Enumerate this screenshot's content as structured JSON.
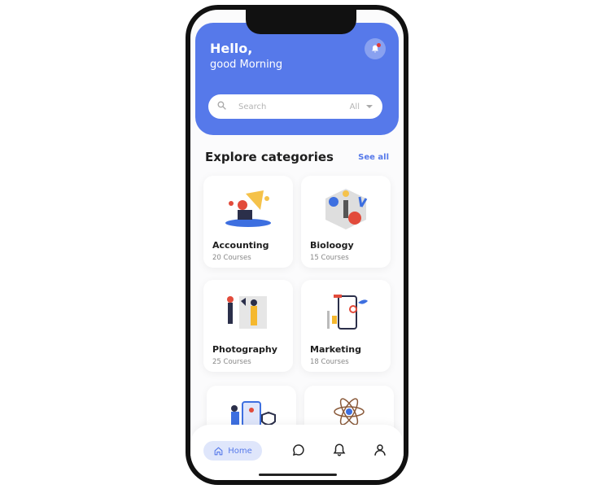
{
  "header": {
    "greeting": "Hello,",
    "subgreeting": "good Morning",
    "notification_icon": "bell-icon",
    "accent_color": "#5679ea"
  },
  "search": {
    "placeholder": "Search",
    "filter_value": "All",
    "icon": "search-icon"
  },
  "section": {
    "title": "Explore categories",
    "see_all": "See all"
  },
  "categories": [
    {
      "title": "Accounting",
      "count": "20 Courses"
    },
    {
      "title": "Bioloogy",
      "count": "15 Courses"
    },
    {
      "title": "Photography",
      "count": "25 Courses"
    },
    {
      "title": "Marketing",
      "count": "18 Courses"
    },
    {
      "title": "",
      "count": ""
    },
    {
      "title": "",
      "count": ""
    }
  ],
  "nav": {
    "home_label": "Home",
    "items": [
      "home-icon",
      "chat-icon",
      "bell-icon",
      "profile-icon"
    ]
  }
}
